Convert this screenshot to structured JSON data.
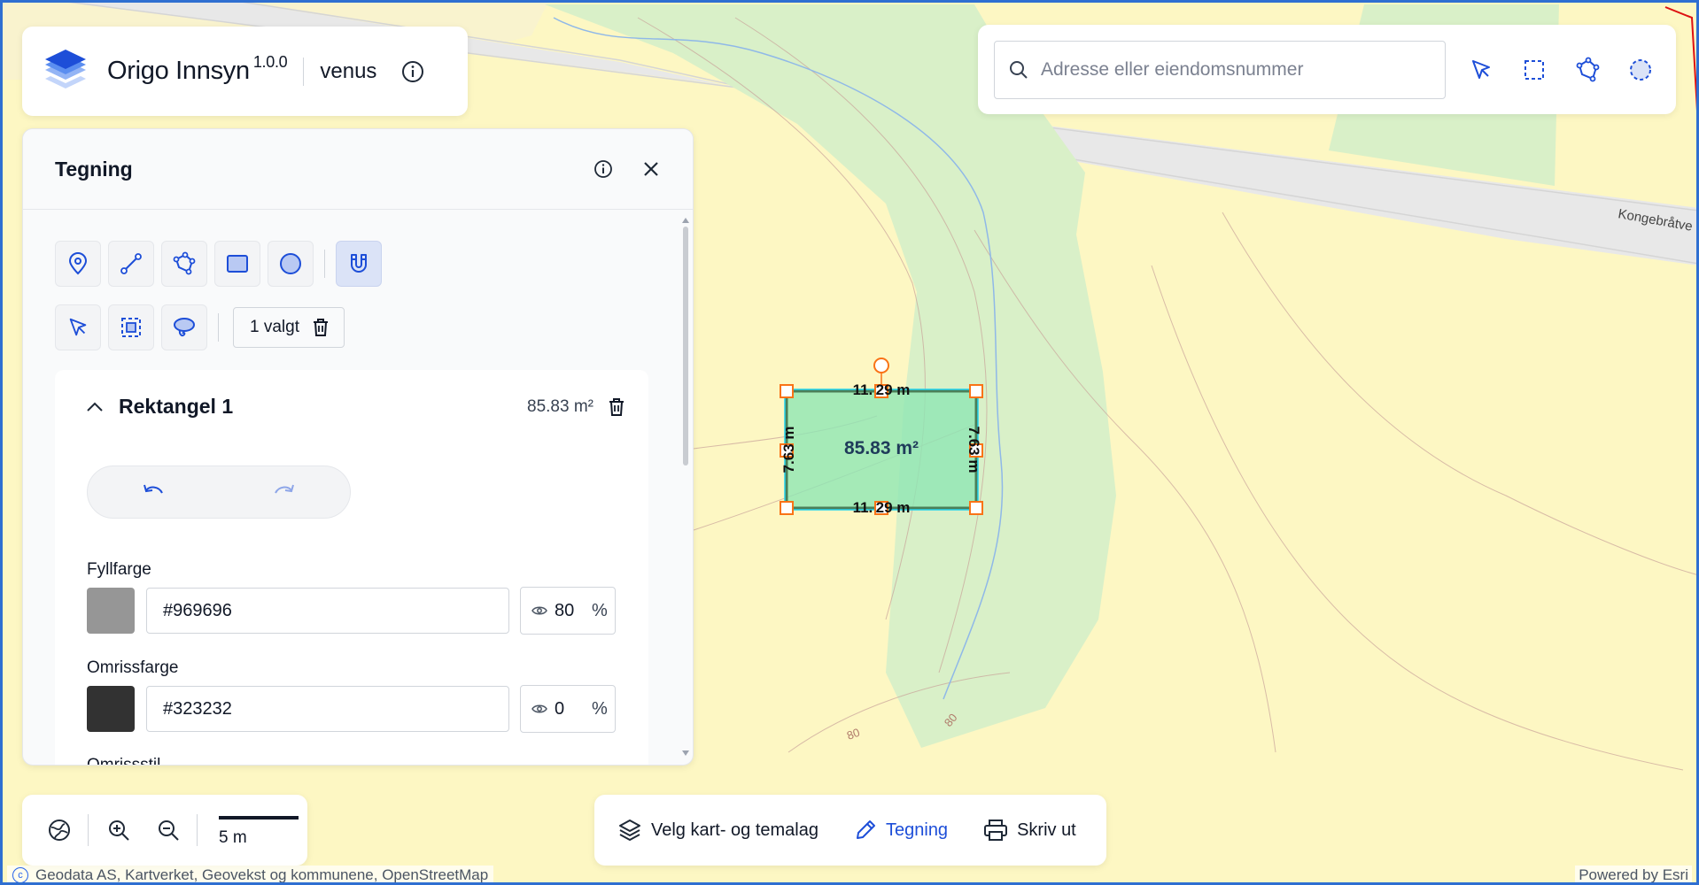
{
  "colors": {
    "accent": "#1d4ed8",
    "map_land": "#fdf7c3",
    "map_green": "#d9f0c8",
    "map_road": "#e9e9e9",
    "shape_fill": "#8ee6b4",
    "shape_handle": "#f97316"
  },
  "header": {
    "title": "Origo Innsyn",
    "version": "1.0.0",
    "user": "venus",
    "info_icon": "info-icon"
  },
  "search": {
    "placeholder": "Adresse eller eiendomsnummer",
    "value": "",
    "tools": [
      "pointer-select-icon",
      "box-select-icon",
      "polygon-select-icon",
      "circle-select-icon"
    ]
  },
  "drawing_panel": {
    "title": "Tegning",
    "draw_tools": [
      "point-icon",
      "line-icon",
      "polygon-icon",
      "rectangle-icon",
      "circle-icon",
      "snap-magnet-icon"
    ],
    "select_tools": [
      "pointer-icon",
      "box-select-icon",
      "lasso-icon"
    ],
    "selection_label": "1 valgt",
    "feature": {
      "name": "Rektangel 1",
      "area": "85.83 m²"
    },
    "fill": {
      "label": "Fyllfarge",
      "swatch": "#969696",
      "hex": "#969696",
      "opacity": "80",
      "unit": "%"
    },
    "stroke": {
      "label": "Omrissfarge",
      "swatch": "#323232",
      "hex": "#323232",
      "opacity": "0",
      "unit": "%"
    },
    "stroke_style_label": "Omrissstil"
  },
  "map": {
    "road_label": "Kongebråtve",
    "contour_labels": [
      "80",
      "80"
    ],
    "shape": {
      "area_label": "85.83 m²",
      "top_label": "11. 29 m",
      "bottom_label": "11. 29 m",
      "left_label": "7.63 m",
      "right_label": "7.63 m"
    }
  },
  "map_controls": {
    "scale_label": "5 m"
  },
  "bottom_bar": {
    "layers_label": "Velg kart- og temalag",
    "drawing_label": "Tegning",
    "print_label": "Skriv ut"
  },
  "attribution": {
    "text": "Geodata AS, Kartverket, Geovekst og kommunene, OpenStreetMap",
    "symbol": "c",
    "powered": "Powered by Esri"
  }
}
